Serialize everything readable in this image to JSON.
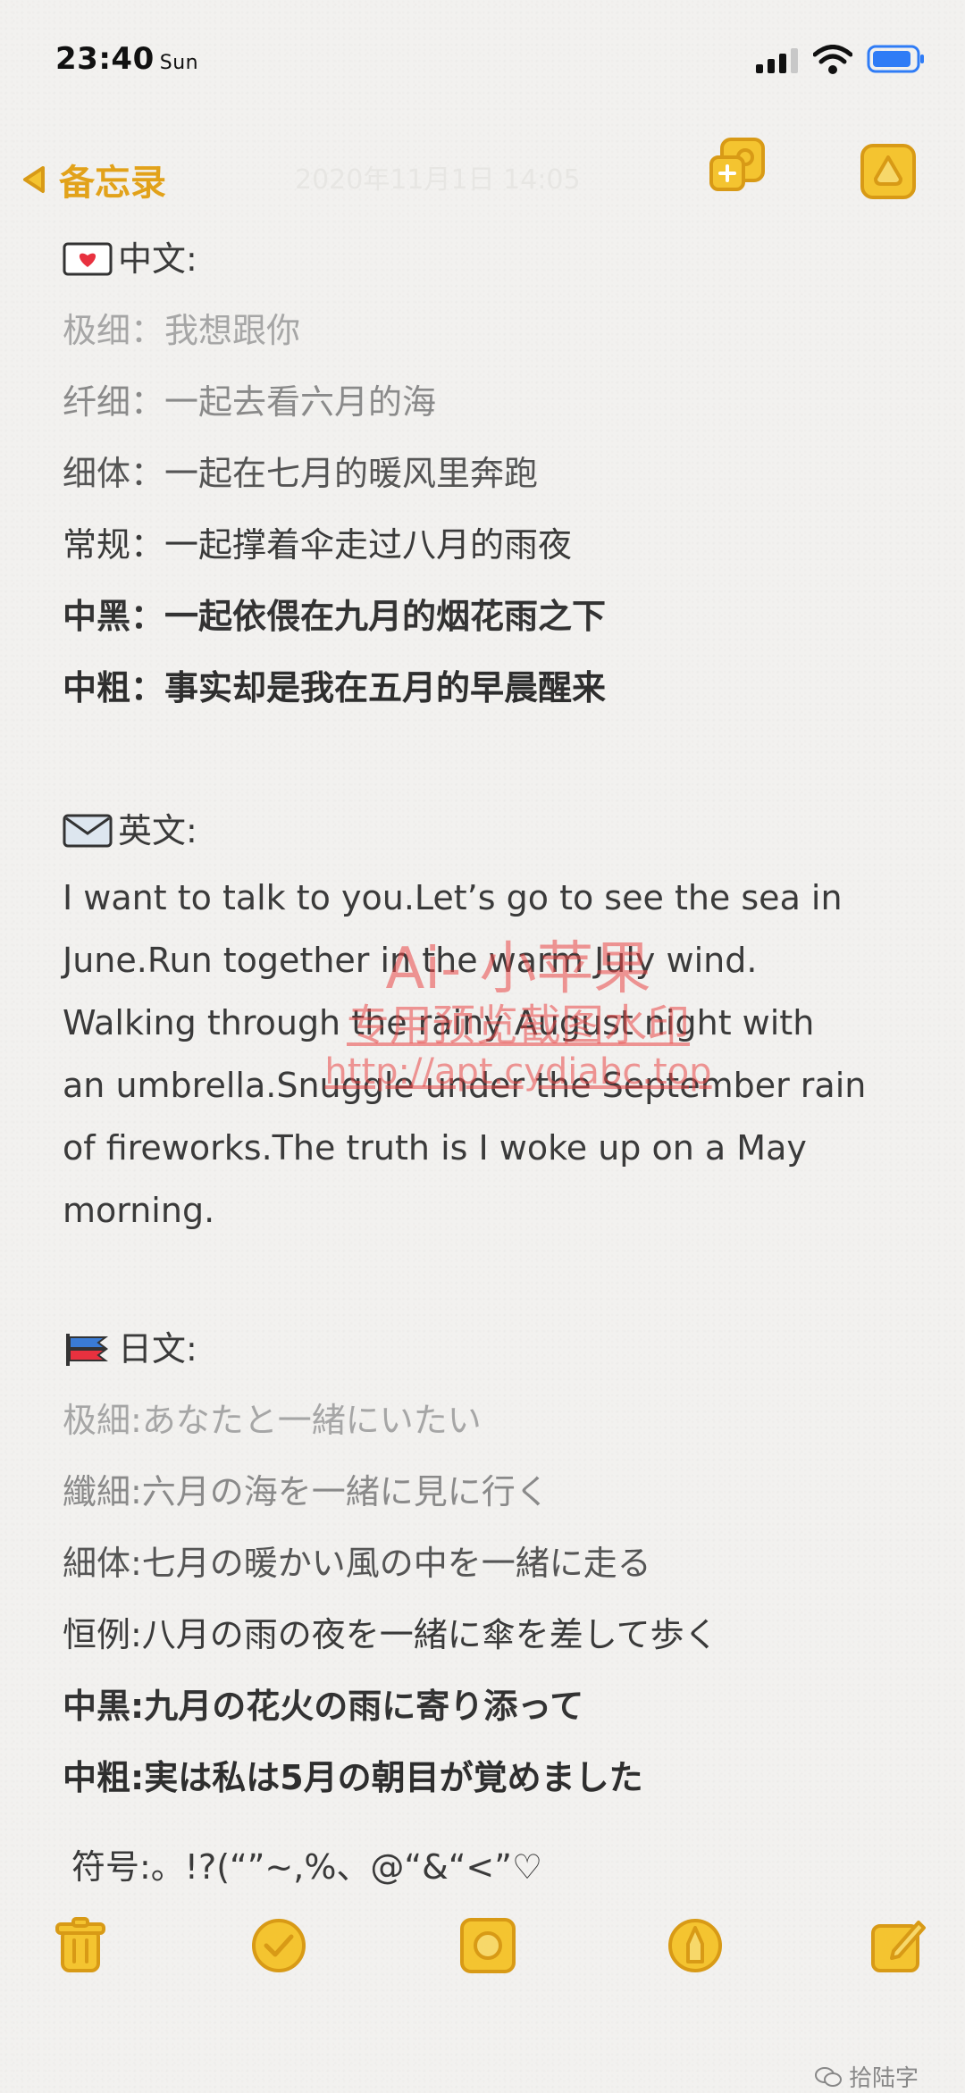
{
  "status": {
    "time": "23:40",
    "day": "Sun"
  },
  "nav": {
    "back_label": "备忘录",
    "date": "2020年11月1日 14:05"
  },
  "note": {
    "chinese": {
      "heading": "中文:",
      "lines": [
        "极细：我想跟你",
        "纤细：一起去看六月的海",
        "细体：一起在七月的暖风里奔跑",
        "常规：一起撑着伞走过八月的雨夜",
        "中黑：一起依偎在九月的烟花雨之下",
        "中粗：事实却是我在五月的早晨醒来"
      ]
    },
    "english": {
      "heading": "英文:",
      "lines": [
        "I want to talk to you.Let’s go to see the sea in",
        "June.Run together in the warm July wind.",
        "Walking through the rainy August night with",
        "an umbrella.Snuggle under the September rain",
        "of fireworks.The truth is I woke up on a May",
        "morning."
      ]
    },
    "japanese": {
      "heading": "日文:",
      "lines": [
        "极細:あなたと一緒にいたい",
        "纖細:六月の海を一緒に見に行く",
        "細体:七月の暖かい風の中を一緒に走る",
        "恒例:八月の雨の夜を一緒に傘を差して歩く",
        "中黒:九月の花火の雨に寄り添って",
        "中粗:実は私は5月の朝目が覚めました"
      ]
    },
    "symbols": "符号:。!?(“”~,%、@“&“<”♡"
  },
  "watermark": {
    "line1": "Ai- 小苹果",
    "line2": "专用预览截图水印",
    "line3": "http://apt.cydiabc.top"
  },
  "footer_brand": "拾陆字",
  "colors": {
    "accent": "#e2a21a",
    "icon_fill": "#f4c430",
    "icon_stroke": "#d89a16"
  }
}
